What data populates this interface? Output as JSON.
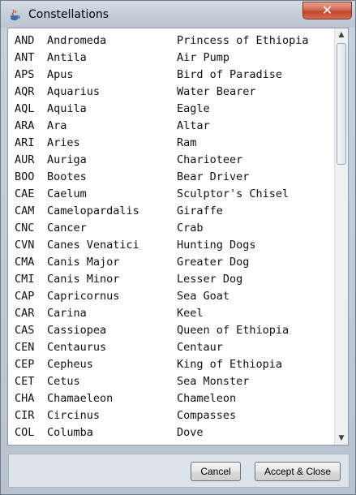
{
  "window": {
    "title": "Constellations",
    "close_label": "✕",
    "app_icon": "java-cup-icon"
  },
  "list": {
    "rows": [
      {
        "abbr": "AND",
        "name": "Andromeda",
        "meaning": "Princess of Ethiopia"
      },
      {
        "abbr": "ANT",
        "name": "Antila",
        "meaning": "Air Pump"
      },
      {
        "abbr": "APS",
        "name": "Apus",
        "meaning": "Bird of Paradise"
      },
      {
        "abbr": "AQR",
        "name": "Aquarius",
        "meaning": "Water Bearer"
      },
      {
        "abbr": "AQL",
        "name": "Aquila",
        "meaning": "Eagle"
      },
      {
        "abbr": "ARA",
        "name": "Ara",
        "meaning": "Altar"
      },
      {
        "abbr": "ARI",
        "name": "Aries",
        "meaning": "Ram"
      },
      {
        "abbr": "AUR",
        "name": "Auriga",
        "meaning": "Charioteer"
      },
      {
        "abbr": "BOO",
        "name": "Bootes",
        "meaning": "Bear Driver"
      },
      {
        "abbr": "CAE",
        "name": "Caelum",
        "meaning": "Sculptor's Chisel"
      },
      {
        "abbr": "CAM",
        "name": "Camelopardalis",
        "meaning": "Giraffe"
      },
      {
        "abbr": "CNC",
        "name": "Cancer",
        "meaning": "Crab"
      },
      {
        "abbr": "CVN",
        "name": "Canes Venatici",
        "meaning": "Hunting Dogs"
      },
      {
        "abbr": "CMA",
        "name": "Canis Major",
        "meaning": "Greater Dog"
      },
      {
        "abbr": "CMI",
        "name": "Canis Minor",
        "meaning": "Lesser Dog"
      },
      {
        "abbr": "CAP",
        "name": "Capricornus",
        "meaning": "Sea Goat"
      },
      {
        "abbr": "CAR",
        "name": "Carina",
        "meaning": "Keel"
      },
      {
        "abbr": "CAS",
        "name": "Cassiopea",
        "meaning": "Queen of Ethiopia"
      },
      {
        "abbr": "CEN",
        "name": "Centaurus",
        "meaning": "Centaur"
      },
      {
        "abbr": "CEP",
        "name": "Cepheus",
        "meaning": "King of Ethiopia"
      },
      {
        "abbr": "CET",
        "name": "Cetus",
        "meaning": "Sea Monster"
      },
      {
        "abbr": "CHA",
        "name": "Chamaeleon",
        "meaning": "Chameleon"
      },
      {
        "abbr": "CIR",
        "name": "Circinus",
        "meaning": "Compasses"
      },
      {
        "abbr": "COL",
        "name": "Columba",
        "meaning": "Dove"
      }
    ]
  },
  "scrollbar": {
    "up_arrow": "▲",
    "down_arrow": "▼"
  },
  "buttons": {
    "cancel": "Cancel",
    "accept": "Accept & Close"
  }
}
